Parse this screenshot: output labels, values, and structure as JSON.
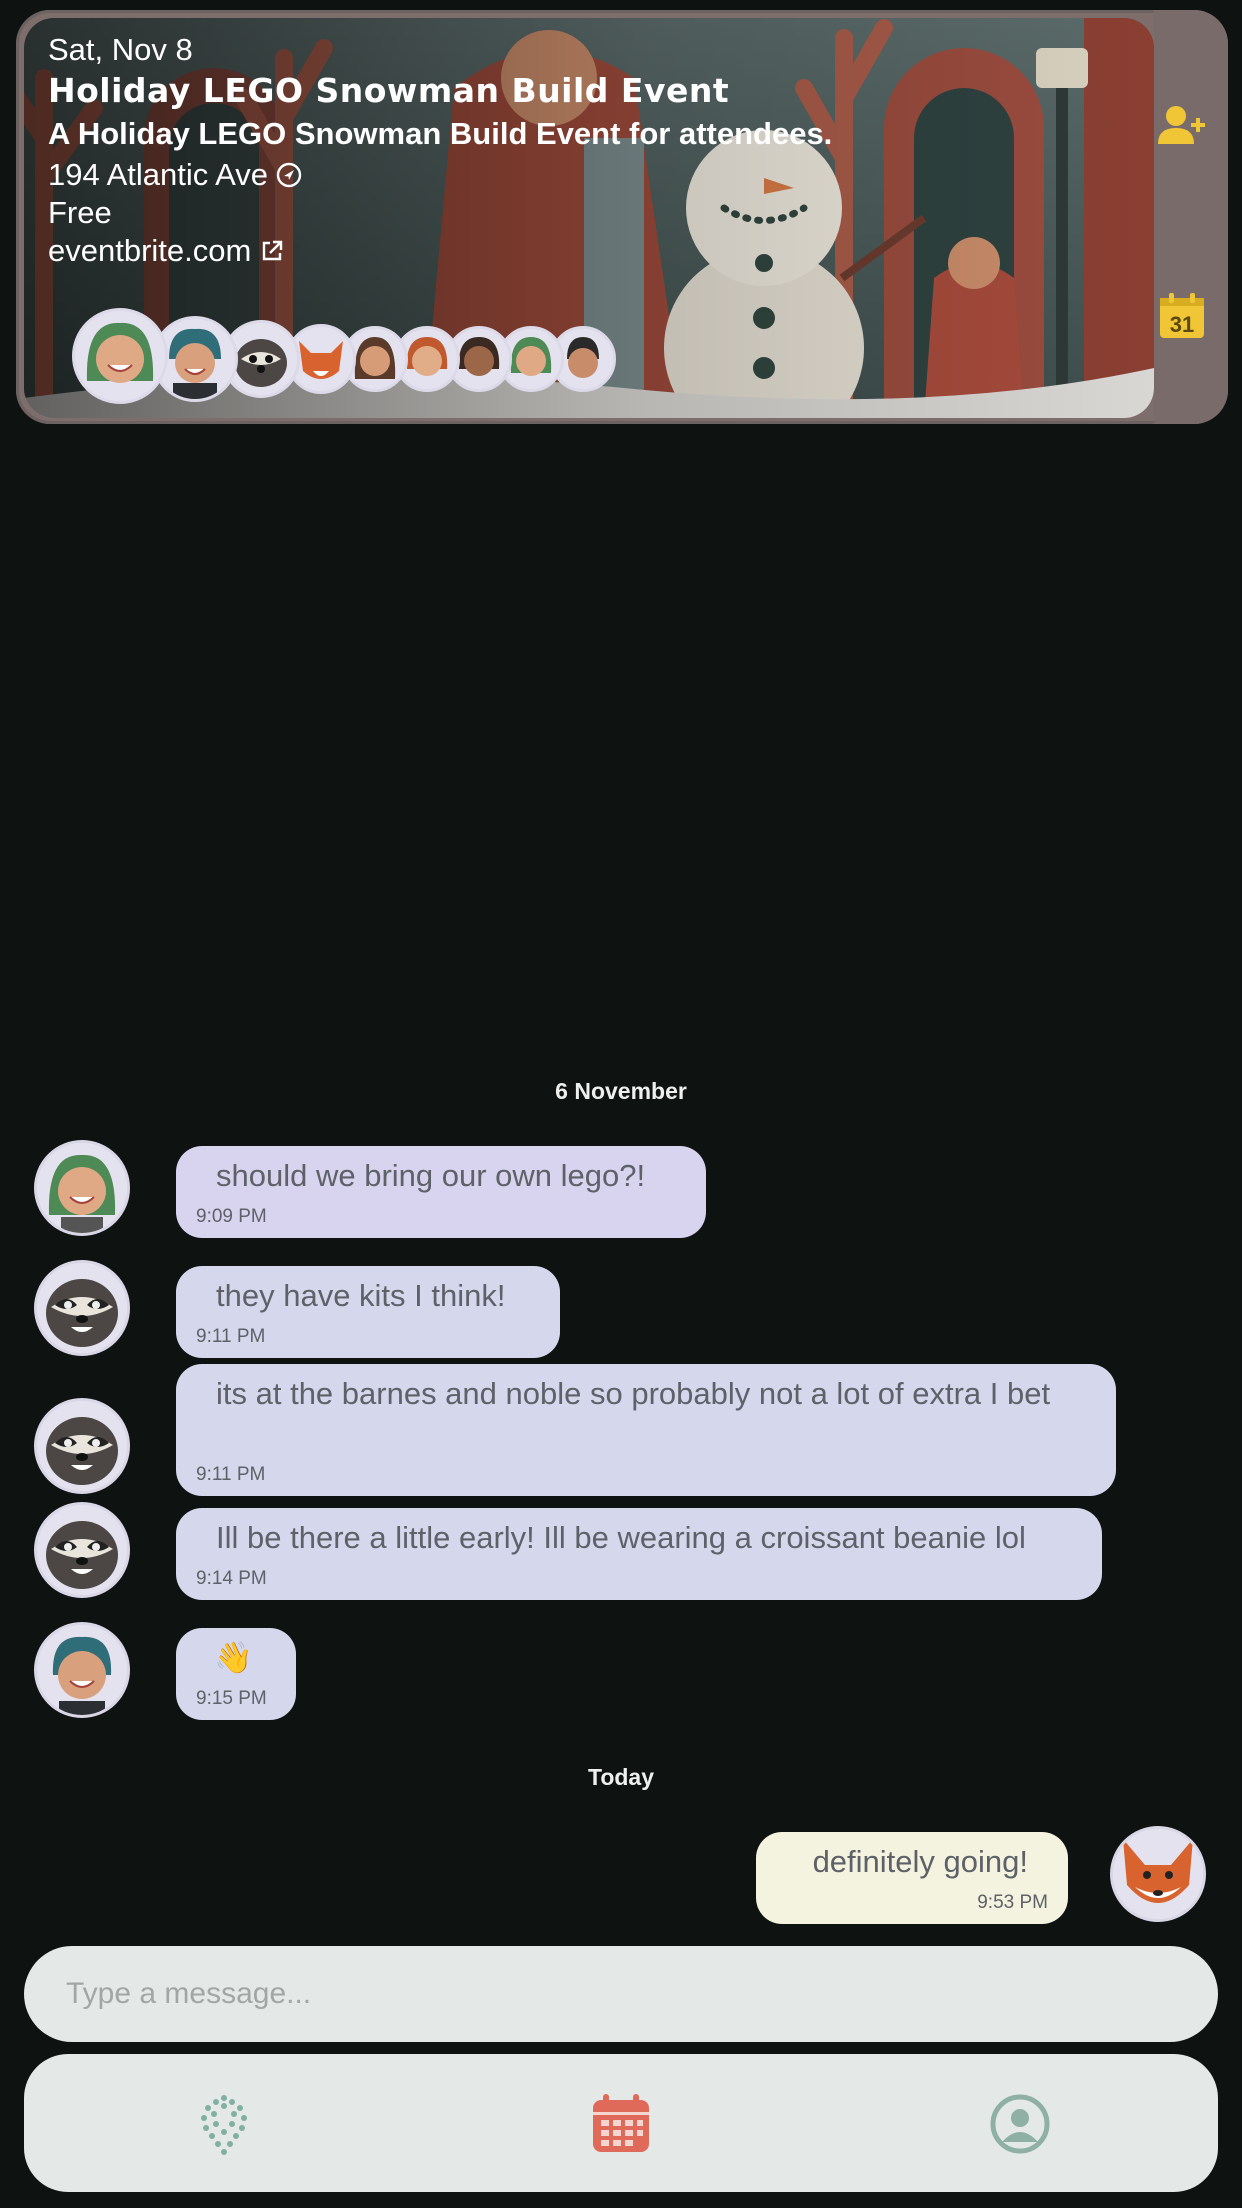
{
  "event": {
    "date": "Sat, Nov 8",
    "title": "Holiday LEGO Snowman Build Event",
    "description": "A Holiday LEGO Snowman Build Event for attendees.",
    "location": "194 Atlantic Ave",
    "price": "Free",
    "link": "eventbrite.com",
    "attendee_count": 9,
    "actions": {
      "invite_icon": "add-person-icon",
      "calendar_icon": "calendar-31-icon",
      "calendar_day": "31"
    },
    "accent_color": "#f0c637"
  },
  "chat": {
    "date_separators": [
      "6 November",
      "Today"
    ],
    "messages": [
      {
        "sender": "green-hair-woman",
        "text": "should we bring our own lego?!",
        "time": "9:09 PM"
      },
      {
        "sender": "raccoon",
        "text": "they have kits I think!",
        "time": "9:11 PM"
      },
      {
        "sender": "raccoon",
        "text": "its at the barnes and noble so probably not a lot of extra I bet",
        "time": "9:11 PM"
      },
      {
        "sender": "raccoon",
        "text": "Ill be there a little early! Ill be wearing a croissant beanie lol",
        "time": "9:14 PM"
      },
      {
        "sender": "teal-hair-woman",
        "text": "👋",
        "time": "9:15 PM"
      },
      {
        "sender": "fox",
        "text": "definitely going!",
        "time": "9:53 PM",
        "outgoing": true
      }
    ]
  },
  "composer": {
    "placeholder": "Type a message..."
  },
  "nav": {
    "items": [
      {
        "icon": "explore-globe-icon",
        "color": "#7fb0a1"
      },
      {
        "icon": "calendar-icon",
        "color": "#e06a5a",
        "active": true
      },
      {
        "icon": "profile-icon",
        "color": "#8fb0a5"
      }
    ]
  }
}
